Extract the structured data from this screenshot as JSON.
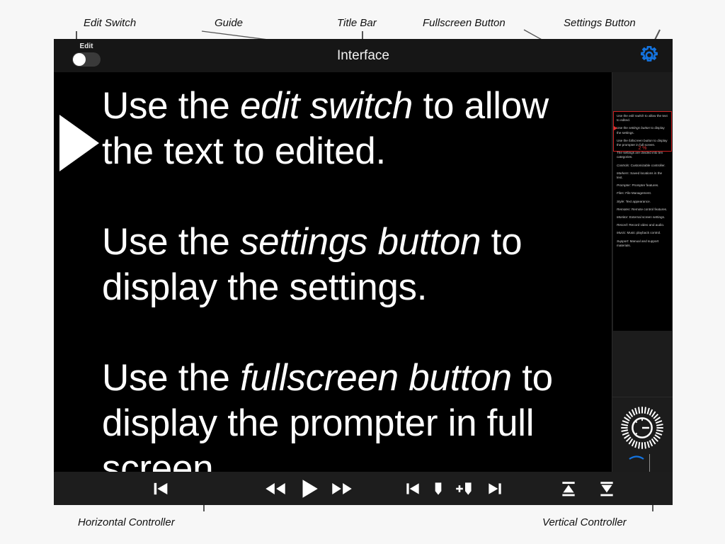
{
  "annotations": [
    {
      "key": "edit_switch",
      "label": "Edit Switch"
    },
    {
      "key": "guide",
      "label": "Guide"
    },
    {
      "key": "title_bar",
      "label": "Title Bar"
    },
    {
      "key": "fullscreen_button",
      "label": "Fullscreen Button"
    },
    {
      "key": "settings_button",
      "label": "Settings Button"
    },
    {
      "key": "horizontal_controller",
      "label": "Horizontal Controller"
    },
    {
      "key": "vertical_controller",
      "label": "Vertical Controller"
    }
  ],
  "window": {
    "title": "Interface",
    "title_bar": {
      "edit_toggle_label": "Edit",
      "edit_toggle_state": "off",
      "settings_icon": "gear-icon",
      "settings_icon_color": "#1474e0"
    },
    "fullscreen_icon": "fullscreen-diagonal-arrows-icon"
  },
  "prompter": {
    "cue_marker_icon": "cue-triangle-icon",
    "paragraphs": [
      {
        "pre": "Use the ",
        "em": "edit switch",
        "post": " to allow the text to edited."
      },
      {
        "pre": "Use the ",
        "em": "settings button",
        "post": " to display the settings."
      },
      {
        "pre": "Use the ",
        "em": "fullscreen button",
        "post": " to display the prompter in full screen."
      }
    ]
  },
  "guide": {
    "progress_label": "2 %",
    "progress_color": "#d33333",
    "highlight_color": "#c22222",
    "pointer_icon": "guide-position-pointer-icon",
    "lines": [
      {
        "pre": "Use the ",
        "em": "edit switch",
        "post": " to allow the text to edited."
      },
      {
        "pre": "Use the ",
        "em": "settings button",
        "post": " to display the settings."
      },
      {
        "pre": "Use the ",
        "em": "fullscreen button",
        "post": " to display the prompter in full screen."
      },
      {
        "pre": "The settings are divided into ten categories.",
        "em": "",
        "post": ""
      },
      {
        "pre": "",
        "em": "Controls",
        "post": ": Customizable controller."
      },
      {
        "pre": "",
        "em": "Markers",
        "post": ": Saved locations in the text."
      },
      {
        "pre": "",
        "em": "Prompter",
        "post": ": Prompter features."
      },
      {
        "pre": "",
        "em": "Files",
        "post": ": File Management."
      },
      {
        "pre": "",
        "em": "Style",
        "post": ": Text appearance."
      },
      {
        "pre": "",
        "em": "Remotes",
        "post": ": Remote control features."
      },
      {
        "pre": "",
        "em": "Monitor",
        "post": ": External screen settings."
      },
      {
        "pre": "",
        "em": "Record",
        "post": ": Record video and audio."
      },
      {
        "pre": "",
        "em": "Music",
        "post": ": Music playback control."
      },
      {
        "pre": "",
        "em": "Support",
        "post": ": Manual and support materials."
      }
    ]
  },
  "vertical_controller": {
    "dial_icon": "speed-dial-knob-icon",
    "arc_icon": "dial-arc-icon",
    "arc_color": "#1474e0",
    "chevron_icon": "chevron-left-icon",
    "chevron_color": "#1474e0"
  },
  "transport": {
    "buttons": [
      {
        "name": "skip-to-start-button",
        "icon": "skip-start-icon"
      },
      {
        "name": "rewind-button",
        "icon": "rewind-icon"
      },
      {
        "name": "play-button",
        "icon": "play-icon"
      },
      {
        "name": "fast-forward-button",
        "icon": "fast-forward-icon"
      },
      {
        "name": "previous-marker-button",
        "icon": "previous-marker-icon"
      },
      {
        "name": "marker-button",
        "icon": "marker-icon"
      },
      {
        "name": "add-marker-button",
        "icon": "add-marker-icon"
      },
      {
        "name": "next-marker-button",
        "icon": "next-marker-icon"
      },
      {
        "name": "scroll-to-top-button",
        "icon": "collapse-up-icon"
      },
      {
        "name": "scroll-to-bottom-button",
        "icon": "collapse-down-icon"
      }
    ]
  }
}
